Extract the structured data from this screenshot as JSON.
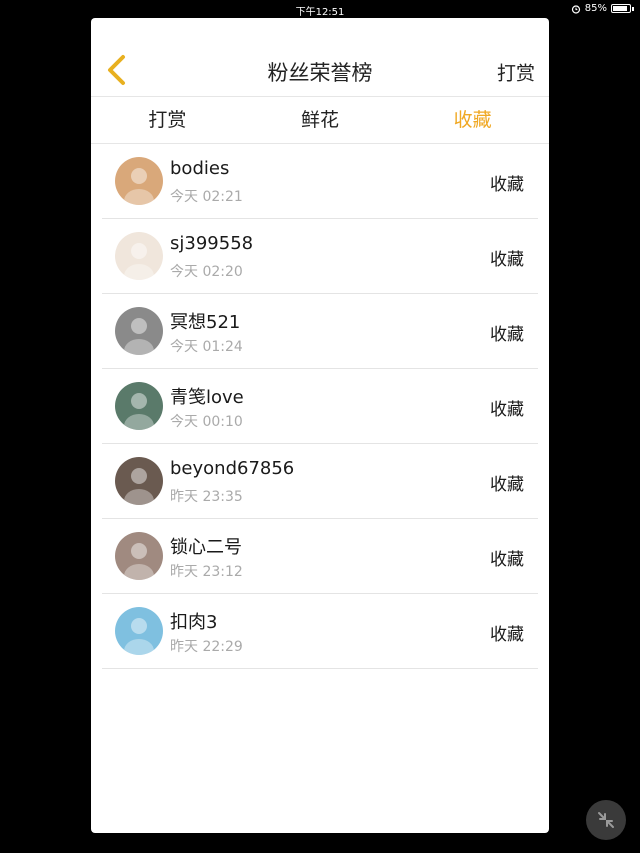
{
  "status_bar": {
    "time": "下午12:51",
    "battery_text": "85%",
    "battery_level": 0.85,
    "alarm_icon": "alarm-clock-icon"
  },
  "header": {
    "back_icon": "chevron-left-icon",
    "title": "粉丝荣誉榜",
    "right_action": "打赏"
  },
  "tabs": [
    {
      "label": "打赏",
      "active": false
    },
    {
      "label": "鲜花",
      "active": false
    },
    {
      "label": "收藏",
      "active": true
    }
  ],
  "colors": {
    "accent": "#f0a823",
    "back_icon": "#e8b020"
  },
  "fans": [
    {
      "name": "bodies",
      "time": "今天 02:21",
      "action": "收藏",
      "avatar_color": "#d9a87a"
    },
    {
      "name": "sj399558",
      "time": "今天 02:20",
      "action": "收藏",
      "avatar_color": "#f0e6dc"
    },
    {
      "name": "冥想521",
      "time": "今天 01:24",
      "action": "收藏",
      "avatar_color": "#8a8a8a"
    },
    {
      "name": "青笺love",
      "time": "今天 00:10",
      "action": "收藏",
      "avatar_color": "#5a7a6a"
    },
    {
      "name": "beyond67856",
      "time": "昨天 23:35",
      "action": "收藏",
      "avatar_color": "#6a5a50"
    },
    {
      "name": "锁心二号",
      "time": "昨天 23:12",
      "action": "收藏",
      "avatar_color": "#a08a80"
    },
    {
      "name": "扣肉3",
      "time": "昨天 22:29",
      "action": "收藏",
      "avatar_color": "#7fc0e0"
    }
  ],
  "floating_button_icon": "collapse-arrows-icon"
}
